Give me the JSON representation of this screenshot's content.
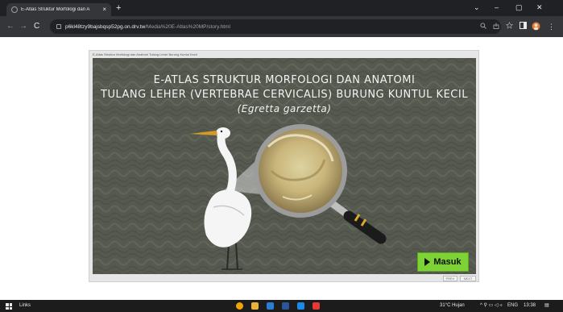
{
  "browser": {
    "tab_title": "E-Atlas Struktur Morfologi dan A",
    "tab_close": "×",
    "new_tab": "+",
    "window_controls": {
      "chevron": "⌄",
      "minimize": "–",
      "restore": "▢",
      "close": "✕"
    },
    "nav": {
      "back": "←",
      "forward": "→",
      "reload": "C"
    },
    "url_host": "p6kl48tzy9bajsbqsp52pg.on.drv.tw",
    "url_path": "/Media%20E-Atlas%20MP/story.html"
  },
  "frame": {
    "title": "E-Atlas Struktur Morfologi dan Anatomi Tulang Leher Burung Kuntul Kecil"
  },
  "slide": {
    "title_line1": "E-ATLAS STRUKTUR MORFOLOGI DAN ANATOMI",
    "title_line2": "TULANG LEHER (VERTEBRAE CERVICALIS) BURUNG KUNTUL KECIL",
    "title_line3": "(Egretta garzetta)",
    "enter_button": "Masuk",
    "prev_label": "PREV",
    "next_label": "NEXT"
  },
  "taskbar": {
    "links_label": "Links",
    "weather": "31°C Hujan",
    "lang": "ENG",
    "time": "13:38"
  },
  "colors": {
    "slide_bg": "#55594f",
    "button_green": "#7dd236",
    "title_text": "#f3f3f3"
  }
}
